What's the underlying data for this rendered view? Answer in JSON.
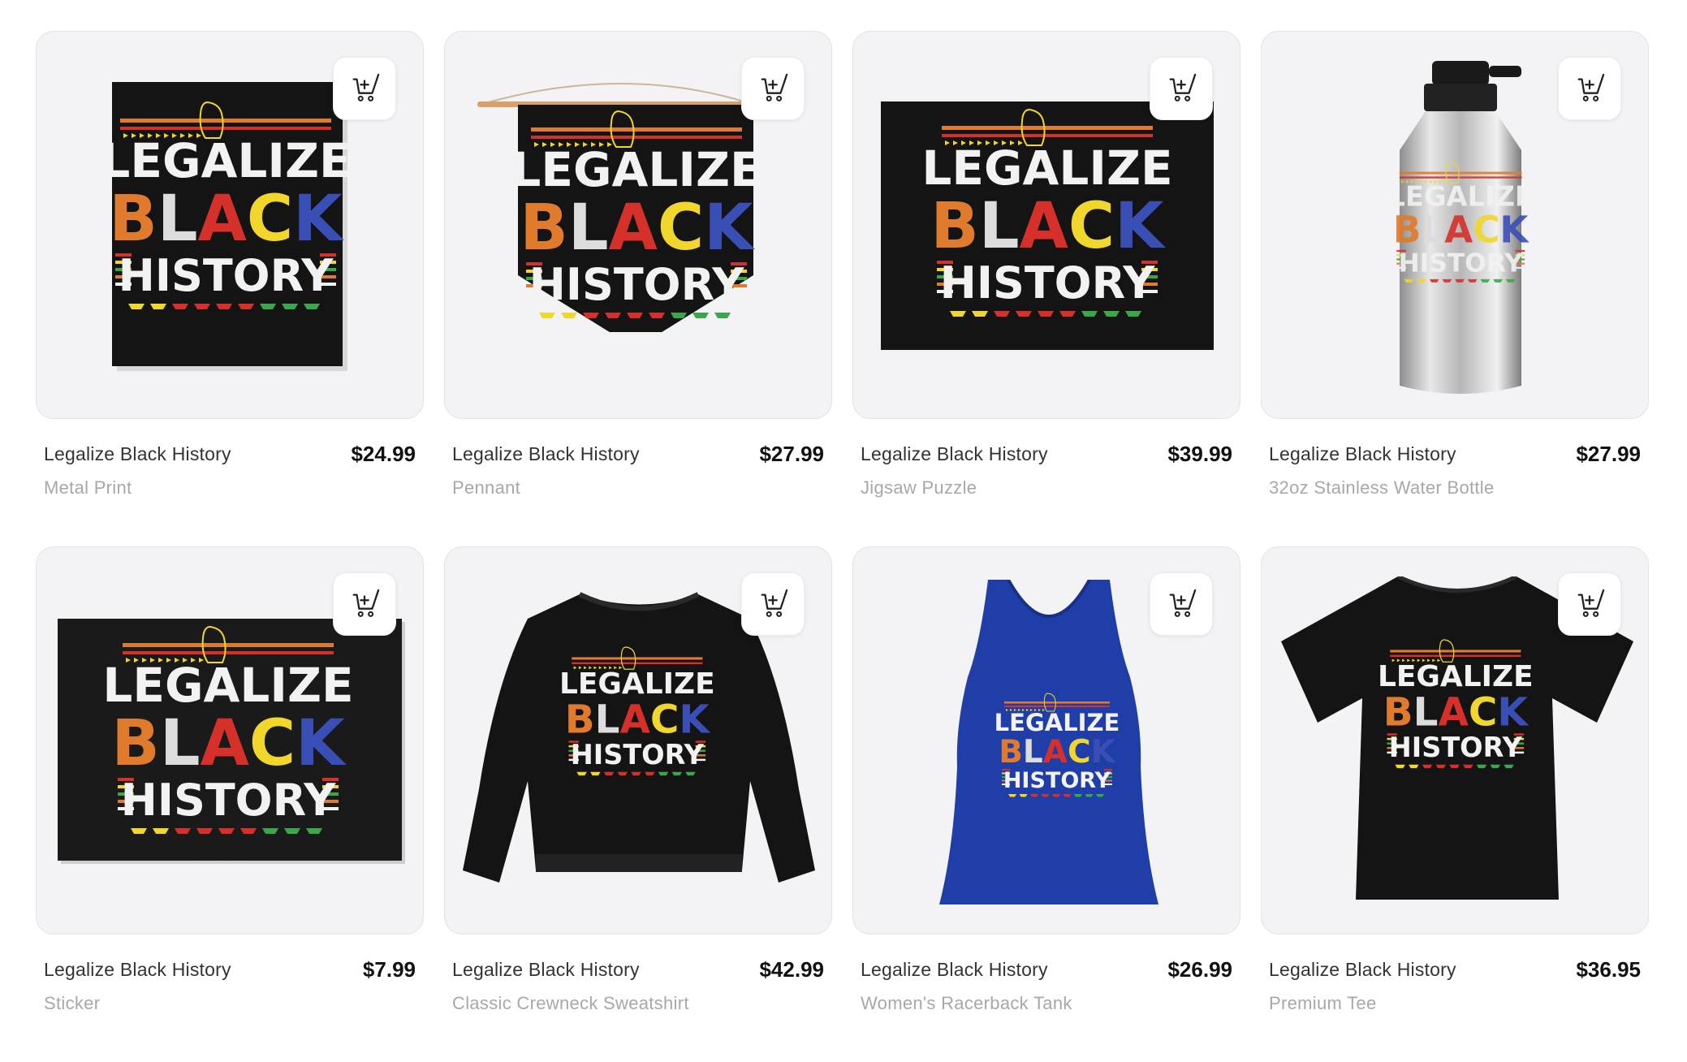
{
  "products": [
    {
      "name": "Legalize Black History",
      "price": "$24.99",
      "type": "Metal Print"
    },
    {
      "name": "Legalize Black History",
      "price": "$27.99",
      "type": "Pennant"
    },
    {
      "name": "Legalize Black History",
      "price": "$39.99",
      "type": "Jigsaw Puzzle"
    },
    {
      "name": "Legalize Black History",
      "price": "$27.99",
      "type": "32oz Stainless Water Bottle"
    },
    {
      "name": "Legalize Black History",
      "price": "$7.99",
      "type": "Sticker"
    },
    {
      "name": "Legalize Black History",
      "price": "$42.99",
      "type": "Classic Crewneck Sweatshirt"
    },
    {
      "name": "Legalize Black History",
      "price": "$26.99",
      "type": "Women's Racerback Tank"
    },
    {
      "name": "Legalize Black History",
      "price": "$36.95",
      "type": "Premium Tee"
    }
  ],
  "design": {
    "line1": "LEGALIZE",
    "line2_letters": [
      "B",
      "L",
      "A",
      "C",
      "K"
    ],
    "line3": "HISTORY",
    "colors": {
      "white": "#f2f2f2",
      "orange": "#e07a2c",
      "grey": "#dcdcdc",
      "red": "#d6302b",
      "yellow": "#f1d62b",
      "blue": "#3a4fb5",
      "green": "#3aa84a",
      "black": "#141414",
      "tank_blue": "#1f3ea8"
    }
  },
  "icons": {
    "cart": "add-to-cart-icon"
  }
}
